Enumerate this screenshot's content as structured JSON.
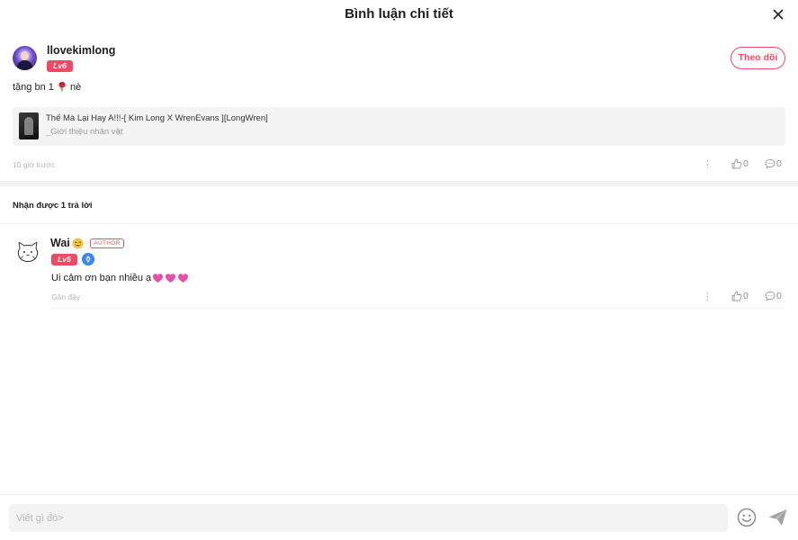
{
  "header": {
    "title": "Bình luận chi tiết",
    "close_icon": "close-icon"
  },
  "comment": {
    "username": "llovekimlong",
    "level": "Lv6",
    "follow_label": "Theo dõi",
    "text_before": "tặng bn 1",
    "text_after": "nè",
    "emoji": "rose-icon",
    "book": {
      "title": "Thế Mà Lại Hay A!!!-[ Kim Long X WrenEvans ][LongWren]",
      "subtitle": "_Giới thiệu nhân vật"
    },
    "time": "10 giờ trước",
    "likes": "0",
    "replies": "0"
  },
  "replies_header": "Nhận được 1 trả lời",
  "reply": {
    "username": "Wai",
    "author_tag": "AUTHOR",
    "level": "Lv5",
    "text": "Ui cảm ơn bạn nhiều ạ",
    "time": "Gần đây",
    "likes": "0",
    "replies": "0"
  },
  "composer": {
    "placeholder": "Viết gì đó>",
    "emoji_icon": "smiley-icon",
    "send_icon": "send-icon"
  },
  "colors": {
    "accent": "#ee4a63",
    "verify": "#3b87f0"
  }
}
